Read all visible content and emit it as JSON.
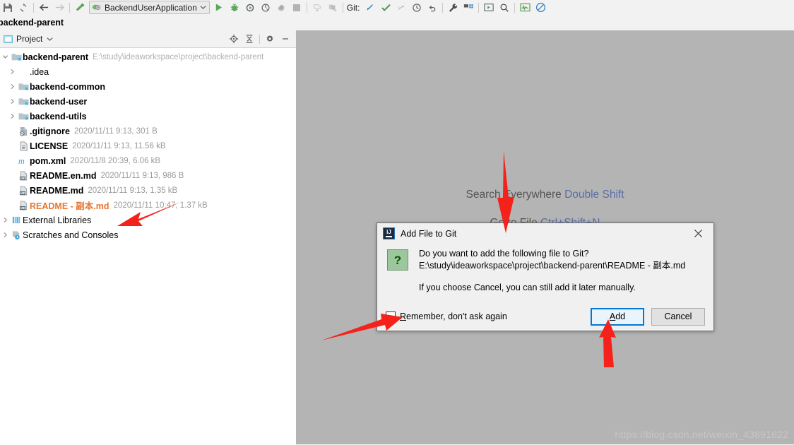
{
  "toolbar": {
    "icons_left": [
      "save-icon",
      "sync-icon",
      "back-arrow-icon",
      "forward-arrow-icon",
      "build-hammer-icon"
    ],
    "run_config": {
      "name": "BackendUserApplication",
      "icon": "spring-boot-icon",
      "chevron": "chevron-down-icon"
    },
    "icons_run": [
      "run-icon",
      "debug-icon",
      "run-with-coverage-icon",
      "profile-icon",
      "rerun-icon",
      "stop-icon"
    ],
    "icons_vcs_disabled": [
      "update-project-icon",
      "commit-icon"
    ],
    "git_label": "Git:",
    "icons_git": [
      "update-project-icon",
      "commit-icon",
      "push-icon",
      "history-icon",
      "rollback-icon"
    ],
    "icons_right": [
      "wrench-icon",
      "structure-icon",
      "run-anything-icon",
      "search-icon",
      "activity-monitor-icon",
      "no-access-icon"
    ]
  },
  "breadcrumb": {
    "text": "backend-parent"
  },
  "project_panel": {
    "title": "Project",
    "title_icon": "project-view-icon",
    "title_chevron": "chevron-down-icon",
    "actions": [
      "locate-icon",
      "collapse-all-icon",
      "settings-gear-icon",
      "minimize-icon"
    ],
    "tree": [
      {
        "level": 0,
        "twisty": "chevron-down-icon",
        "icon": "project-root-folder-icon",
        "name": "backend-parent",
        "bold": true,
        "meta": "E:\\study\\ideaworkspace\\project\\backend-parent",
        "meta_kind": "path"
      },
      {
        "level": 1,
        "twisty": "chevron-right-icon",
        "icon": "folder-icon",
        "name": ".idea",
        "bold": false,
        "meta": ""
      },
      {
        "level": 1,
        "twisty": "chevron-right-icon",
        "icon": "module-folder-icon",
        "name": "backend-common",
        "bold": true,
        "meta": ""
      },
      {
        "level": 1,
        "twisty": "chevron-right-icon",
        "icon": "module-folder-icon",
        "name": "backend-user",
        "bold": true,
        "meta": ""
      },
      {
        "level": 1,
        "twisty": "chevron-right-icon",
        "icon": "module-folder-icon",
        "name": "backend-utils",
        "bold": true,
        "meta": ""
      },
      {
        "level": 2,
        "twisty": "",
        "icon": "gitignore-file-icon",
        "name": ".gitignore",
        "bold": true,
        "meta": "2020/11/11 9:13, 301 B"
      },
      {
        "level": 2,
        "twisty": "",
        "icon": "text-file-icon",
        "name": "LICENSE",
        "bold": true,
        "meta": "2020/11/11 9:13, 11.56 kB"
      },
      {
        "level": 2,
        "twisty": "",
        "icon": "maven-pom-icon",
        "name": "pom.xml",
        "bold": true,
        "meta": "2020/11/8 20:39, 6.06 kB"
      },
      {
        "level": 2,
        "twisty": "",
        "icon": "markdown-file-icon",
        "name": "README.en.md",
        "bold": true,
        "meta": "2020/11/11 9:13, 986 B"
      },
      {
        "level": 2,
        "twisty": "",
        "icon": "markdown-file-icon",
        "name": "README.md",
        "bold": true,
        "meta": "2020/11/11 9:13, 1.35 kB"
      },
      {
        "level": 2,
        "twisty": "",
        "icon": "markdown-file-icon",
        "name": "README - 副本.md",
        "bold": true,
        "color": "unversioned",
        "meta": "2020/11/11 10:47, 1.37 kB"
      },
      {
        "level": 1,
        "twisty": "chevron-right-icon",
        "icon": "external-libraries-icon",
        "name": "External Libraries",
        "bold": false,
        "meta": ""
      },
      {
        "level": 1,
        "twisty": "chevron-right-icon",
        "icon": "scratches-icon",
        "name": "Scratches and Consoles",
        "bold": false,
        "meta": ""
      }
    ]
  },
  "editor": {
    "hints": [
      {
        "action": "Search Everywhere",
        "shortcut": "Double Shift"
      },
      {
        "action": "Go to File",
        "shortcut": "Ctrl+Shift+N"
      }
    ],
    "watermark": "https://blog.csdn.net/weixin_43891622"
  },
  "dialog": {
    "title": "Add File to Git",
    "title_icon": "intellij-idea-icon",
    "close_icon": "close-icon",
    "question_icon": "question-mark-icon",
    "message_line1": "Do you want to add the following file to Git?",
    "message_line2": "E:\\study\\ideaworkspace\\project\\backend-parent\\README - 副本.md",
    "message_line3": "If you choose Cancel, you can still add it later manually.",
    "checkbox": {
      "checked": false,
      "label_pre": "",
      "label_mnemonic": "R",
      "label_post": "emember, don't ask again"
    },
    "buttons": [
      {
        "label_mnemonic": "A",
        "label_post": "dd",
        "default": true
      },
      {
        "label_mnemonic": "",
        "label_post": "Cancel",
        "default": false
      }
    ]
  },
  "colors": {
    "accent_blue": "#0078d7",
    "unversioned_orange": "#e8762c",
    "editor_bg": "#b4b4b4",
    "annotation_red": "#f5221b",
    "hint_key_blue": "#5b6fa8"
  }
}
